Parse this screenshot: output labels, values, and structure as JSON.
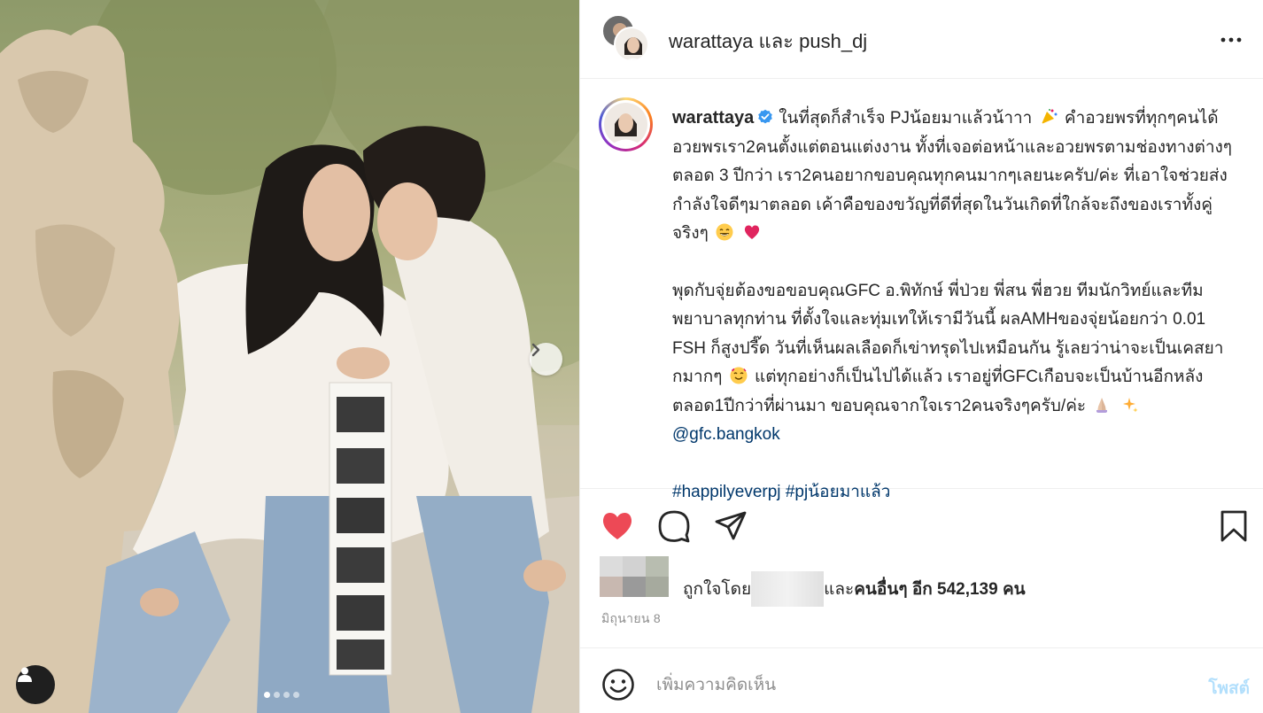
{
  "header": {
    "user1": "warattaya",
    "conjunction": "และ",
    "user2": "push_dj",
    "more_icon": "more-horizontal-icon"
  },
  "caption": {
    "username": "warattaya",
    "verified_icon": "verified-badge-icon",
    "paragraph1_a": "ในที่สุดก็สำเร็จ PJน้อยมาแล้วน้าาา",
    "paragraph1_b": "คำอวยพรที่ทุกๆคนได้อวยพรเรา2คนตั้งแต่ตอนแต่งงาน ทั้งที่เจอต่อหน้าและอวยพรตามช่องทางต่างๆตลอด 3 ปีกว่า เรา2คนอยากขอบคุณทุกคนมากๆเลยนะครับ/ค่ะ ที่เอาใจช่วยส่งกำลังใจดีๆมาตลอด เค้าคือของขวัญที่ดีที่สุดในวันเกิดที่ใกล้จะถึงของเราทั้งคู่จริงๆ",
    "paragraph2_a": "พุดกับจุ่ยต้องขอขอบคุณGFC อ.พิทักษ์ พี่ป่วย พี่สน พี่ฮวย ทีมนักวิทย์และทีมพยาบาลทุกท่าน ที่ตั้งใจและทุ่มเทให้เรามีวันนี้ ผลAMHของจุ่ยน้อยกว่า 0.01 FSH ก็สูงปรี๊ด วันที่เห็นผลเลือดก็เข่าทรุดไปเหมือนกัน รู้เลยว่าน่าจะเป็นเคสยากมากๆ",
    "paragraph2_b": "แต่ทุกอย่างก็เป็นไปได้แล้ว เราอยู่ที่GFCเกือบจะเป็นบ้านอีกหลังตลอด1ปีกว่าที่ผ่านมา ขอบคุณจากใจเรา2คนจริงๆครับ/ค่ะ",
    "mention": "@gfc.bangkok",
    "hashtag1": "#happilyeverpj",
    "hashtag2": "#pjน้อยมาแล้ว"
  },
  "actions": {
    "like_icon": "heart-filled-icon",
    "comment_icon": "comment-icon",
    "share_icon": "share-icon",
    "save_icon": "bookmark-icon"
  },
  "likes": {
    "prefix": "ถูกใจโดย",
    "middle": "และ",
    "others_label": "คนอื่นๆ",
    "suffix": "อีก 542,139 คน"
  },
  "date": "มิถุนายน 8",
  "comment": {
    "placeholder": "เพิ่มความคิดเห็น",
    "post_label": "โพสต์",
    "emoji_icon": "smiley-icon"
  },
  "media": {
    "next_icon": "chevron-right-icon",
    "tag_icon": "user-tag-icon",
    "carousel_total": 4,
    "carousel_active": 1
  },
  "colors": {
    "like_red": "#ed4956",
    "link_blue": "#00376b",
    "verified_blue": "#3897f0",
    "post_disabled": "#b2dffc"
  }
}
